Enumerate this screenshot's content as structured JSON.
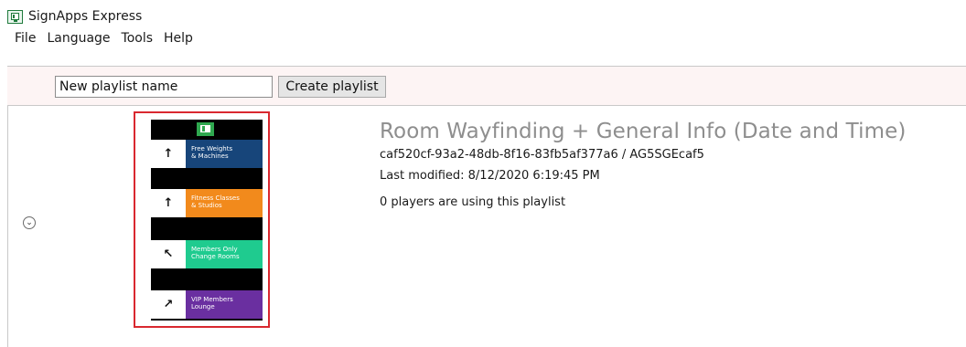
{
  "window": {
    "title": "SignApps Express",
    "icon": "signapps-app-icon"
  },
  "menu": {
    "items": [
      {
        "label": "File"
      },
      {
        "label": "Language"
      },
      {
        "label": "Tools"
      },
      {
        "label": "Help"
      }
    ]
  },
  "toolbar": {
    "playlist_name_value": "New playlist name",
    "create_label": "Create playlist"
  },
  "playlist": {
    "title": "Room Wayfinding + General Info (Date and Time)",
    "id_line": "caf520cf-93a2-48db-8f16-83fb5af377a6 / AG5SGEcaf5",
    "last_modified": "Last modified: 8/12/2020 6:19:45 PM",
    "players_using": "0 players are using this playlist",
    "expand_icon": "chevron-down-icon",
    "thumbnail": {
      "header_icon": "signapps-logo-icon",
      "signs": [
        {
          "arrow": "↑",
          "arrow_icon": "arrow-up-icon",
          "label_line1": "Free Weights",
          "label_line2": "& Machines",
          "color": "#17457a"
        },
        {
          "arrow": "↑",
          "arrow_icon": "arrow-up-icon",
          "label_line1": "Fitness Classes",
          "label_line2": "& Studios",
          "color": "#f28a1c"
        },
        {
          "arrow": "↖",
          "arrow_icon": "arrow-up-left-icon",
          "label_line1": "Members Only",
          "label_line2": "Change Rooms",
          "color": "#1fcb8f"
        },
        {
          "arrow": "↗",
          "arrow_icon": "arrow-up-right-icon",
          "label_line1": "VIP Members",
          "label_line2": "Lounge",
          "color": "#6a2fa0"
        }
      ]
    },
    "highlight_color": "#d9282f"
  }
}
